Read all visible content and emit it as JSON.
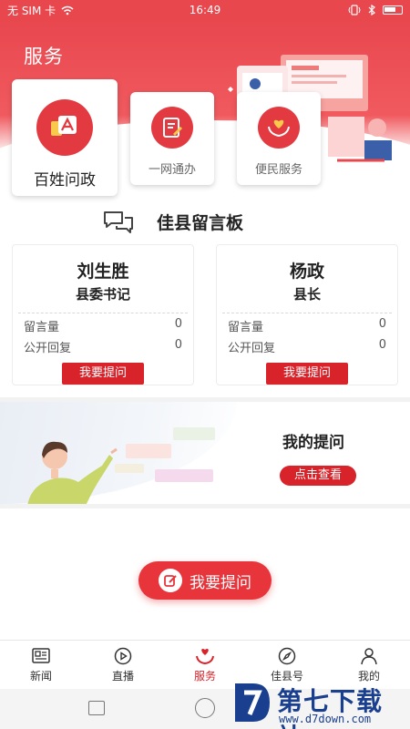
{
  "status_bar": {
    "carrier": "无 SIM 卡",
    "time": "16:49"
  },
  "header": {
    "title": "服务"
  },
  "services": [
    {
      "label": "百姓问政",
      "icon": "letter-a-chat-icon"
    },
    {
      "label": "一网通办",
      "icon": "document-pen-icon"
    },
    {
      "label": "便民服务",
      "icon": "heart-hands-icon"
    }
  ],
  "board": {
    "title": "佳县留言板"
  },
  "officials": [
    {
      "name": "刘生胜",
      "title": "县委书记",
      "messages_label": "留言量",
      "messages": "0",
      "replies_label": "公开回复",
      "replies": "0",
      "button": "我要提问"
    },
    {
      "name": "杨政",
      "title": "县长",
      "messages_label": "留言量",
      "messages": "0",
      "replies_label": "公开回复",
      "replies": "0",
      "button": "我要提问"
    }
  ],
  "my_question": {
    "title": "我的提问",
    "button": "点击查看"
  },
  "ask_button": {
    "label": "我要提问"
  },
  "bottom_nav": [
    {
      "label": "新闻",
      "icon": "newspaper-icon",
      "active": false
    },
    {
      "label": "直播",
      "icon": "play-icon",
      "active": false
    },
    {
      "label": "服务",
      "icon": "heart-hand-icon",
      "active": true
    },
    {
      "label": "佳县号",
      "icon": "compass-icon",
      "active": false
    },
    {
      "label": "我的",
      "icon": "person-icon",
      "active": false
    }
  ],
  "watermark": {
    "text": "第七下载站",
    "url": "www.d7down.com"
  },
  "colors": {
    "primary": "#d9232a",
    "header": "#e8474e"
  }
}
